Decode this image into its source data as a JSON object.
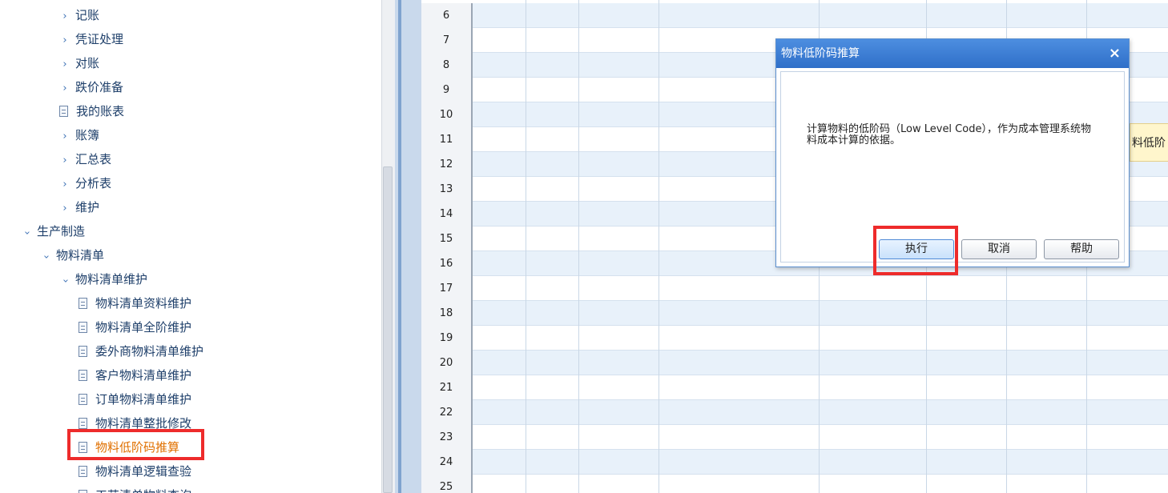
{
  "tree": {
    "items": [
      {
        "label": "记账",
        "kind": "collapsed",
        "indent": 1
      },
      {
        "label": "凭证处理",
        "kind": "collapsed",
        "indent": 1
      },
      {
        "label": "对账",
        "kind": "collapsed",
        "indent": 1
      },
      {
        "label": "跌价准备",
        "kind": "collapsed",
        "indent": 1
      },
      {
        "label": "我的账表",
        "kind": "leaf",
        "indent": 1
      },
      {
        "label": "账簿",
        "kind": "collapsed",
        "indent": 1
      },
      {
        "label": "汇总表",
        "kind": "collapsed",
        "indent": 1
      },
      {
        "label": "分析表",
        "kind": "collapsed",
        "indent": 1
      },
      {
        "label": "维护",
        "kind": "collapsed",
        "indent": 1
      },
      {
        "label": "生产制造",
        "kind": "expanded",
        "indent": 0
      },
      {
        "label": "物料清单",
        "kind": "expanded",
        "indent": 0.5
      },
      {
        "label": "物料清单维护",
        "kind": "expanded",
        "indent": 1
      },
      {
        "label": "物料清单资料维护",
        "kind": "leaf",
        "indent": 2
      },
      {
        "label": "物料清单全阶维护",
        "kind": "leaf",
        "indent": 2
      },
      {
        "label": "委外商物料清单维护",
        "kind": "leaf",
        "indent": 2
      },
      {
        "label": "客户物料清单维护",
        "kind": "leaf",
        "indent": 2
      },
      {
        "label": "订单物料清单维护",
        "kind": "leaf",
        "indent": 2
      },
      {
        "label": "物料清单整批修改",
        "kind": "leaf",
        "indent": 2
      },
      {
        "label": "物料低阶码推算",
        "kind": "leaf",
        "indent": 2,
        "selected": true
      },
      {
        "label": "物料清单逻辑查验",
        "kind": "leaf",
        "indent": 2
      },
      {
        "label": "工艺清单物料查询",
        "kind": "leaf",
        "indent": 2
      }
    ]
  },
  "grid": {
    "row_numbers": [
      "6",
      "7",
      "8",
      "9",
      "10",
      "11",
      "12",
      "13",
      "14",
      "15",
      "16",
      "17",
      "18",
      "19",
      "20",
      "21",
      "22",
      "23",
      "24",
      "25"
    ]
  },
  "tooltip_fragment": "料低阶",
  "dialog": {
    "title": "物料低阶码推算",
    "close_glyph": "×",
    "message": "计算物料的低阶码（Low Level Code），作为成本管理系统物料成本计算的依据。",
    "buttons": {
      "execute": "执行",
      "cancel": "取消",
      "help": "帮助"
    }
  },
  "colors": {
    "selected_text": "#e07000",
    "highlight_border": "#ee2b2b",
    "dialog_title_bar": "#3b7dd8",
    "grid_alt_row": "#e8f1fa"
  }
}
